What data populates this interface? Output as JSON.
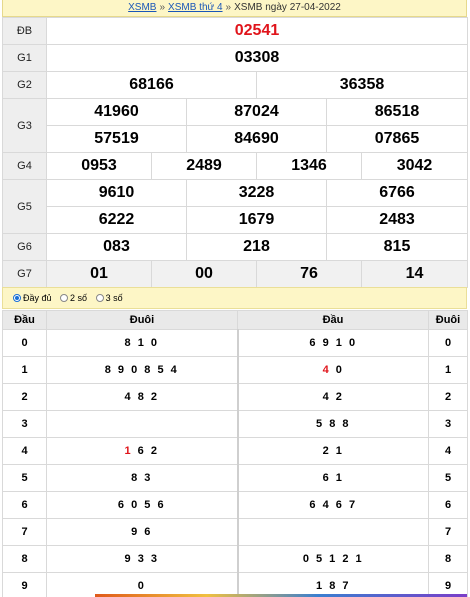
{
  "breadcrumb": {
    "home": "XSMB",
    "weekday": "XSMB thứ 4",
    "current": "XSMB ngày 27-04-2022",
    "sep": "»"
  },
  "results": [
    {
      "label": "ĐB",
      "values": [
        "02541"
      ]
    },
    {
      "label": "G1",
      "values": [
        "03308"
      ]
    },
    {
      "label": "G2",
      "values": [
        "68166",
        "36358"
      ]
    },
    {
      "label": "G3",
      "values": [
        "41960",
        "87024",
        "86518",
        "57519",
        "84690",
        "07865"
      ]
    },
    {
      "label": "G4",
      "values": [
        "0953",
        "2489",
        "1346",
        "3042"
      ]
    },
    {
      "label": "G5",
      "values": [
        "9610",
        "3228",
        "6766",
        "6222",
        "1679",
        "2483"
      ]
    },
    {
      "label": "G6",
      "values": [
        "083",
        "218",
        "815"
      ]
    },
    {
      "label": "G7",
      "values": [
        "01",
        "00",
        "76",
        "14"
      ]
    }
  ],
  "options": {
    "full": "Đầy đủ",
    "two": "2 số",
    "three": "3 số",
    "selected": "full"
  },
  "loto": {
    "headers": {
      "dau": "Đầu",
      "duoi": "Đuôi",
      "dau2": "Đầu",
      "duoi2": "Đuôi"
    },
    "rows": [
      {
        "d": "0",
        "tail": "8 1 0",
        "tail_hl": "",
        "head": "6 9 1 0",
        "head_hl": "",
        "n": "0"
      },
      {
        "d": "1",
        "tail": "8 9 0 8 5 4",
        "tail_hl": "",
        "head": " 0",
        "head_hl": "4",
        "n": "1"
      },
      {
        "d": "2",
        "tail": "4 8 2",
        "tail_hl": "",
        "head": "4 2",
        "head_hl": "",
        "n": "2"
      },
      {
        "d": "3",
        "tail": "",
        "tail_hl": "",
        "head": "5 8 8",
        "head_hl": "",
        "n": "3"
      },
      {
        "d": "4",
        "tail": " 6 2",
        "tail_hl": "1",
        "head": "2 1",
        "head_hl": "",
        "n": "4"
      },
      {
        "d": "5",
        "tail": "8 3",
        "tail_hl": "",
        "head": "6 1",
        "head_hl": "",
        "n": "5"
      },
      {
        "d": "6",
        "tail": "6 0 5 6",
        "tail_hl": "",
        "head": "6 4 6 7",
        "head_hl": "",
        "n": "6"
      },
      {
        "d": "7",
        "tail": "9 6",
        "tail_hl": "",
        "head": "",
        "head_hl": "",
        "n": "7"
      },
      {
        "d": "8",
        "tail": "9 3 3",
        "tail_hl": "",
        "head": "0 5 1 2 1",
        "head_hl": "",
        "n": "8"
      },
      {
        "d": "9",
        "tail": "0",
        "tail_hl": "",
        "head": "1 8 7",
        "head_hl": "",
        "n": "9"
      }
    ]
  },
  "colors": {
    "accent_red": "#e0141b",
    "link_blue": "#1a57b8",
    "banner_yellow": "#fdf6c6"
  }
}
